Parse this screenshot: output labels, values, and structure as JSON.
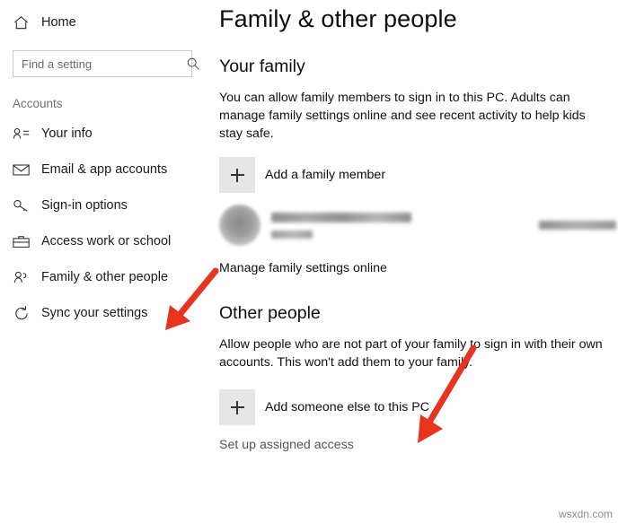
{
  "sidebar": {
    "home": {
      "label": "Home",
      "icon": "home-icon"
    },
    "search": {
      "placeholder": "Find a setting",
      "icon": "search-icon"
    },
    "section_label": "Accounts",
    "items": [
      {
        "label": "Your info",
        "icon": "person-card-icon"
      },
      {
        "label": "Email & app accounts",
        "icon": "envelope-icon"
      },
      {
        "label": "Sign-in options",
        "icon": "key-icon"
      },
      {
        "label": "Access work or school",
        "icon": "briefcase-icon"
      },
      {
        "label": "Family & other people",
        "icon": "people-icon"
      },
      {
        "label": "Sync your settings",
        "icon": "sync-icon"
      }
    ]
  },
  "main": {
    "page_title": "Family & other people",
    "family": {
      "heading": "Your family",
      "description": "You can allow family members to sign in to this PC. Adults can manage family settings online and see recent activity to help kids stay safe.",
      "add_member_label": "Add a family member",
      "manage_link": "Manage family settings online"
    },
    "other_people": {
      "heading": "Other people",
      "description": "Allow people who are not part of your family to sign in with their own accounts. This won't add them to your family.",
      "add_someone_label": "Add someone else to this PC",
      "assigned_access_link": "Set up assigned access"
    }
  },
  "watermark": "wsxdn.com",
  "colors": {
    "arrow_red": "#e8331f",
    "plus_box": "#e6e6e6",
    "muted_text": "#6f6f6f"
  }
}
